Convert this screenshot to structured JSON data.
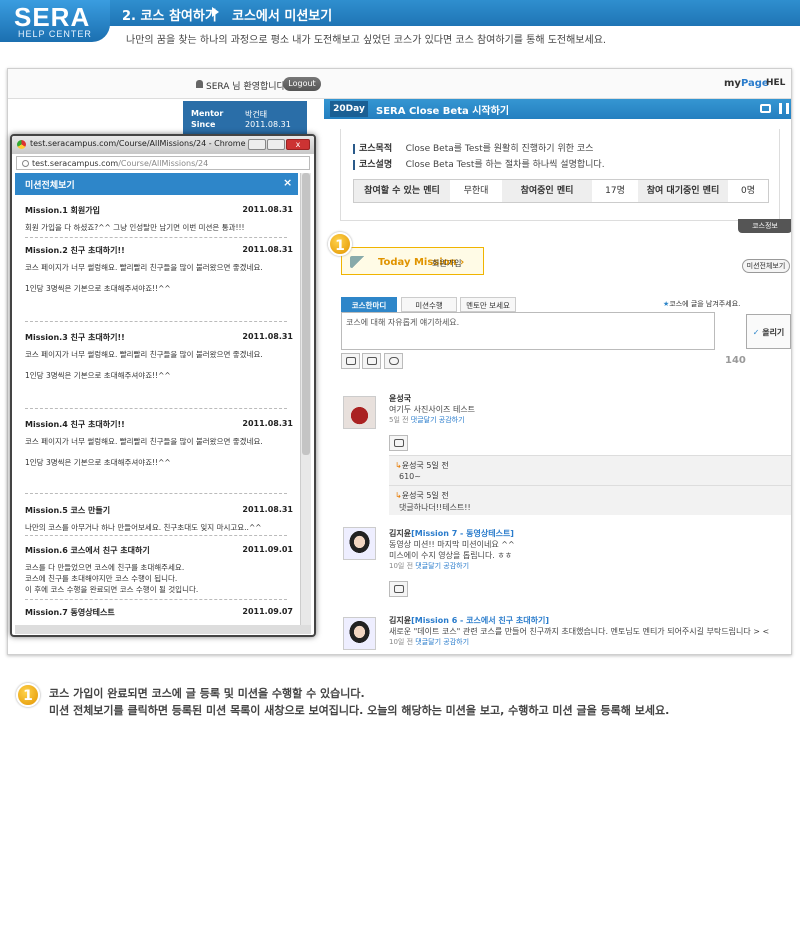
{
  "header": {
    "logo_main": "SERA",
    "logo_sub": "HELP CENTER",
    "crumb1": "2. 코스 참여하기",
    "crumb2": "코스에서 미션보기",
    "subtitle": "나만의 꿈을 찾는 하나의 과정으로 평소 내가 도전해보고 싶었던 코스가 있다면 코스 참여하기를 통해 도전해보세요."
  },
  "topbar": {
    "welcome": "SERA 님 환영합니다.",
    "logout": "Logout",
    "mypage_my": "my",
    "mypage_page": "Page",
    "help": "HEL"
  },
  "sidebar": {
    "mentor_label": "Mentor",
    "since_label": "Since",
    "mentor_name": "박건태",
    "since_date": "2011.08.31"
  },
  "course": {
    "day_badge": "20Day",
    "title": "SERA Close Beta 시작하기",
    "purpose_label": "코스목적",
    "purpose": "Close Beta를 Test를 원활히 진행하기 위한 코스",
    "desc_label": "코스설명",
    "desc": "Close Beta Test를 하는 절차를 하나씩 설명합니다.",
    "stats": [
      {
        "label": "참여할 수 있는 멘티",
        "value": "무한대"
      },
      {
        "label": "참여중인 멘티",
        "value": "17명"
      },
      {
        "label": "참여 대기중인 멘티",
        "value": "0명"
      }
    ],
    "info_tab": "코스정보"
  },
  "today_mission": {
    "badge": "1",
    "label": "Today Mission ›",
    "mission": "회원가입",
    "all_button": "미션전체보기"
  },
  "write": {
    "tabs": [
      "코스한마디",
      "미션수행",
      "멘토만 보세요"
    ],
    "hint_star": "★",
    "hint": "코스에 글을 남겨주세요.",
    "placeholder": "코스에 대해 자유롭게 얘기하세요.",
    "post_check": "✓",
    "post_label": "올리기",
    "char_count": "140"
  },
  "feed": [
    {
      "name": "윤성국",
      "mission": "",
      "text1": "여기두 사진사이즈 테스트",
      "text2": "",
      "meta_time": "5일 전",
      "meta_reply": "댓글달기",
      "meta_like": "공감하기",
      "replies": [
        {
          "arrow": "↳",
          "name": "윤성국 5일 전",
          "text": "610~"
        },
        {
          "arrow": "↳",
          "name": "윤성국 5일 전",
          "text": "댓글하나더!!테스트!!"
        }
      ]
    },
    {
      "name": "김지윤",
      "mission": "[Mission 7 - 동영상테스트]",
      "text1": "동영상 미션!! 마지막 미션이네요 ^^",
      "text2": "미스에이 수지 영상을 톱립니다. ㅎㅎ",
      "meta_time": "10일 전",
      "meta_reply": "댓글달기",
      "meta_like": "공감하기"
    },
    {
      "name": "김지윤",
      "mission": "[Mission 6 - 코스에서 친구 초대하기]",
      "text1": "새로운 \"데이트 코스\" 관련 코스를 만들어 친구까지 초대했습니다. 멘토님도 멘티가 되어주시길 부탁드립니다 > <",
      "meta_time": "10일 전",
      "meta_reply": "댓글달기",
      "meta_like": "공감하기"
    }
  ],
  "popup": {
    "window_title": "test.seracampus.com/Course/AllMissions/24 - Chrome",
    "url_host": "test.seracampus.com",
    "url_path": "/Course/AllMissions/24",
    "close_glyph": "x",
    "head": "미션전체보기",
    "head_close": "×",
    "missions": [
      {
        "title": "Mission.1 회원가입",
        "date": "2011.08.31",
        "lines": [
          "회원 가입을 다 하셨죠?^^ 그냥 인성탈만 남기면 이번 미션은 통과!!!"
        ]
      },
      {
        "title": "Mission.2 친구 초대하기!!",
        "date": "2011.08.31",
        "lines": [
          "코스 페이지가 너무 썰렁해요. 빨리빨리 친구들을 많이 불러왔으면 좋겠네요.",
          "",
          "1인당 3명씩은 기본으로 초대해주셔야죠!!^^"
        ]
      },
      {
        "title": "Mission.3 친구 초대하기!!",
        "date": "2011.08.31",
        "lines": [
          "코스 페이지가 너무 썰렁해요. 빨리빨리 친구들을 많이 불러왔으면 좋겠네요.",
          "",
          "1인당 3명씩은 기본으로 초대해주셔야죠!!^^"
        ]
      },
      {
        "title": "Mission.4 친구 초대하기!!",
        "date": "2011.08.31",
        "lines": [
          "코스 페이지가 너무 썰렁해요. 빨리빨리 친구들을 많이 불러왔으면 좋겠네요.",
          "",
          "1인당 3명씩은 기본으로 초대해주셔야죠!!^^"
        ]
      },
      {
        "title": "Mission.5 코스 만들기",
        "date": "2011.08.31",
        "lines": [
          "나만의 코스를 아무거나 하나 만들어보세요. 친구초대도 잊지 마시고요..^^"
        ]
      },
      {
        "title": "Mission.6 코스에서 친구 초대하기",
        "date": "2011.09.01",
        "lines": [
          "코스를 다 만들었으면 코스에 친구를 초대해주세요.",
          "코스에 친구를 초대해야지만 코스 수행이 됩니다.",
          "이 후에 코스 수행을 완료되면 코스 수행이 될 것입니다."
        ]
      },
      {
        "title": "Mission.7 동영상테스트",
        "date": "2011.09.07",
        "lines": []
      }
    ]
  },
  "caption": {
    "badge": "1",
    "line1": "코스 가입이 완료되면 코스에 글 등록 및 미션을 수행할 수 있습니다.",
    "line2": "미션 전체보기를 클릭하면 등록된 미션 목록이 새창으로 보여집니다. 오늘의 해당하는 미션을 보고, 수행하고 미션 글을 등록해 보세요."
  }
}
